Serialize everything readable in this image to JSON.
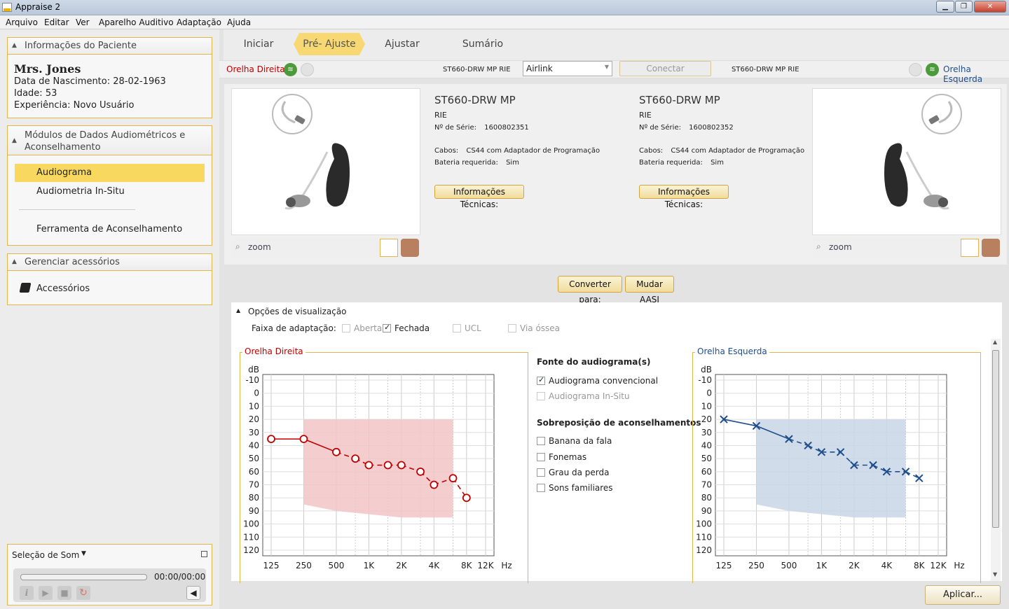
{
  "window": {
    "title": "Appraise 2",
    "min": "▁",
    "max": "❐",
    "close": "✕"
  },
  "menu": [
    "Arquivo",
    "Editar",
    "Ver",
    "Aparelho Auditivo",
    "Adaptação",
    "Ajuda"
  ],
  "patient": {
    "header": "Informações do Paciente",
    "name": "Mrs. Jones",
    "dob": "Data de Nascimento: 28-02-1963",
    "age": "Idade: 53",
    "experience": "Experiência: Novo Usuário"
  },
  "modules": {
    "header": "Módulos de Dados Audiométricos e Aconselhamento",
    "items": [
      "Audiograma",
      "Audiometria In-Situ",
      "Ferramenta de Aconselhamento"
    ],
    "selected": "Audiograma"
  },
  "accessories": {
    "header": "Gerenciar acessórios",
    "item": "Accessórios"
  },
  "sound": {
    "header": "Seleção de Som",
    "time": "00:00/00:00"
  },
  "tabs": [
    "Iniciar",
    "Pré- Ajuste",
    "Ajustar",
    "Sumário"
  ],
  "devicebar": {
    "right_ear": "Orelha Direita",
    "left_ear": "Orelha Esquerda",
    "model_right": "ST660-DRW MP  RIE",
    "model_left": "ST660-DRW MP  RIE",
    "connection": "Airlink",
    "connect": "Conectar"
  },
  "devices": [
    {
      "model": "ST660-DRW MP",
      "type": "RIE",
      "serial_label": "Nº de Série:",
      "serial": "1600802351",
      "cables_label": "Cabos:",
      "cables": "CS44 com Adaptador de Programação",
      "battery_label": "Bateria requerida:",
      "battery": "Sim",
      "tech": "Informações Técnicas:"
    },
    {
      "model": "ST660-DRW MP",
      "type": "RIE",
      "serial_label": "Nº de Série:",
      "serial": "1600802352",
      "cables_label": "Cabos:",
      "cables": "CS44 com Adaptador de Programação",
      "battery_label": "Bateria requerida:",
      "battery": "Sim",
      "tech": "Informações Técnicas:"
    }
  ],
  "zoom": "zoom",
  "convert": "Converter para:",
  "change": "Mudar AASI",
  "view_options": {
    "title": "Opções de visualização",
    "range_label": "Faixa de adaptação:",
    "open": "Aberta",
    "closed": "Fechada",
    "ucl": "UCL",
    "bone": "Via óssea"
  },
  "audiogram_source": {
    "title": "Fonte do audiograma(s)",
    "conventional": "Audiograma convencional",
    "insitu": "Audiograma In-Situ"
  },
  "overlay": {
    "title": "Sobreposição de aconselhamentos",
    "items": [
      "Banana da fala",
      "Fonemas",
      "Grau da perda",
      "Sons familiares"
    ]
  },
  "apply": "Aplicar...",
  "colors": {
    "right": "#c00000",
    "left": "#1f4e8c",
    "accent": "#f7d873"
  },
  "chart_data": [
    {
      "type": "line",
      "title": "Orelha Direita",
      "ylabel": "dB",
      "xlabel": "Hz",
      "x_ticks": [
        "125",
        "250",
        "500",
        "1K",
        "2K",
        "4K",
        "8K",
        "12K"
      ],
      "y_ticks": [
        "-10",
        "0",
        "10",
        "20",
        "30",
        "40",
        "50",
        "60",
        "70",
        "80",
        "90",
        "100",
        "110",
        "120"
      ],
      "ylim": [
        -10,
        120
      ],
      "y_inverted": true,
      "series": [
        {
          "marker": "circle",
          "color": "#c00000",
          "points": [
            [
              125,
              35
            ],
            [
              250,
              35
            ],
            [
              500,
              45
            ],
            [
              750,
              50
            ],
            [
              1000,
              55
            ],
            [
              1500,
              55
            ],
            [
              2000,
              55
            ],
            [
              3000,
              60
            ],
            [
              4000,
              70
            ],
            [
              6000,
              65
            ],
            [
              8000,
              80
            ]
          ]
        }
      ],
      "fit_range": {
        "color": "#f2c4c7",
        "freq_low": 250,
        "freq_high": 6000,
        "upper_db": 20,
        "lower_db": [
          [
            250,
            85
          ],
          [
            500,
            90
          ],
          [
            2000,
            95
          ],
          [
            6000,
            95
          ]
        ]
      }
    },
    {
      "type": "line",
      "title": "Orelha Esquerda",
      "ylabel": "dB",
      "xlabel": "Hz",
      "x_ticks": [
        "125",
        "250",
        "500",
        "1K",
        "2K",
        "4K",
        "8K",
        "12K"
      ],
      "y_ticks": [
        "-10",
        "0",
        "10",
        "20",
        "30",
        "40",
        "50",
        "60",
        "70",
        "80",
        "90",
        "100",
        "110",
        "120"
      ],
      "ylim": [
        -10,
        120
      ],
      "y_inverted": true,
      "series": [
        {
          "marker": "x",
          "color": "#1f4e8c",
          "points": [
            [
              125,
              20
            ],
            [
              250,
              25
            ],
            [
              500,
              35
            ],
            [
              750,
              40
            ],
            [
              1000,
              45
            ],
            [
              1500,
              45
            ],
            [
              2000,
              55
            ],
            [
              3000,
              55
            ],
            [
              4000,
              60
            ],
            [
              6000,
              60
            ],
            [
              8000,
              65
            ]
          ]
        }
      ],
      "fit_range": {
        "color": "#c9d6e6",
        "freq_low": 250,
        "freq_high": 6000,
        "upper_db": 20,
        "lower_db": [
          [
            250,
            85
          ],
          [
            500,
            90
          ],
          [
            2000,
            95
          ],
          [
            6000,
            95
          ]
        ]
      }
    }
  ]
}
